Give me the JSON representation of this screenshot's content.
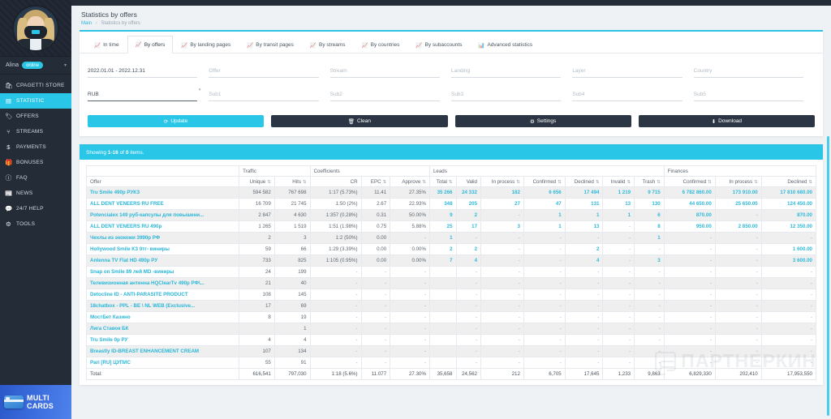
{
  "sidebar": {
    "user": {
      "name": "Alina",
      "status": "online",
      "caret": "chevron-down"
    },
    "items": [
      {
        "icon": "🛍",
        "label": "CPAGETTI STORE",
        "active": false
      },
      {
        "icon": "▤",
        "label": "STATISTIC",
        "active": true
      },
      {
        "icon": "🏷",
        "label": "OFFERS",
        "active": false
      },
      {
        "icon": "⑂",
        "label": "STREAMS",
        "active": false
      },
      {
        "icon": "$",
        "label": "PAYMENTS",
        "active": false
      },
      {
        "icon": "🎁",
        "label": "BONUSES",
        "active": false
      },
      {
        "icon": "ⓘ",
        "label": "FAQ",
        "active": false
      },
      {
        "icon": "📰",
        "label": "NEWS",
        "active": false
      },
      {
        "icon": "💬",
        "label": "24/7 HELP",
        "active": false
      },
      {
        "icon": "⚙",
        "label": "TOOLS",
        "active": false
      }
    ],
    "promo": {
      "line1": "MULTI",
      "line2": "CARDS"
    }
  },
  "header": {
    "title": "Statistics by offers",
    "breadcrumb_home": "Main",
    "breadcrumb_sep": "›",
    "breadcrumb_current": "Statistics by offers"
  },
  "tabs": [
    {
      "icon": "📈",
      "label": "In time",
      "active": false
    },
    {
      "icon": "📈",
      "label": "By offers",
      "active": true
    },
    {
      "icon": "📈",
      "label": "By landing pages",
      "active": false
    },
    {
      "icon": "📈",
      "label": "By transit pages",
      "active": false
    },
    {
      "icon": "📈",
      "label": "By streams",
      "active": false
    },
    {
      "icon": "📈",
      "label": "By countries",
      "active": false
    },
    {
      "icon": "📈",
      "label": "By subaccounts",
      "active": false
    },
    {
      "icon": "📊",
      "label": "Advanced statistics",
      "active": false
    }
  ],
  "filters": {
    "row1": [
      {
        "name": "date-range",
        "value": "2022.01.01 - 2022.12.31",
        "placeholder": ""
      },
      {
        "name": "offer",
        "value": "",
        "placeholder": "Offer"
      },
      {
        "name": "stream",
        "value": "",
        "placeholder": "Stream"
      },
      {
        "name": "landing",
        "value": "",
        "placeholder": "Landing"
      },
      {
        "name": "layer",
        "value": "",
        "placeholder": "Layer"
      },
      {
        "name": "country",
        "value": "",
        "placeholder": "Country"
      }
    ],
    "row2": [
      {
        "name": "currency",
        "value": "RUB",
        "placeholder": ""
      },
      {
        "name": "sub1",
        "value": "",
        "placeholder": "Sub1"
      },
      {
        "name": "sub2",
        "value": "",
        "placeholder": "Sub2"
      },
      {
        "name": "sub3",
        "value": "",
        "placeholder": "Sub3"
      },
      {
        "name": "sub4",
        "value": "",
        "placeholder": "Sub4"
      },
      {
        "name": "sub5",
        "value": "",
        "placeholder": "Sub5"
      }
    ]
  },
  "buttons": {
    "update": {
      "icon": "⟳",
      "label": "Update"
    },
    "clean": {
      "icon": "🗑",
      "label": "Clean"
    },
    "settings": {
      "icon": "⚙",
      "label": "Settings"
    },
    "download": {
      "icon": "⬇",
      "label": "Download"
    }
  },
  "showing": {
    "prefix": "Showing ",
    "range": "1-16",
    "mid": " of ",
    "count": "0",
    "suffix": " items."
  },
  "table": {
    "groups": [
      {
        "label": "",
        "span": 1
      },
      {
        "label": "Traffic",
        "span": 2
      },
      {
        "label": "Coefficients",
        "span": 3
      },
      {
        "label": "Leads",
        "span": 7
      },
      {
        "label": "Finances",
        "span": 3
      }
    ],
    "columns": [
      {
        "label": "Offer",
        "sortable": false,
        "align": "left"
      },
      {
        "label": "Unique",
        "sortable": true,
        "align": "right"
      },
      {
        "label": "Hits",
        "sortable": true,
        "align": "right"
      },
      {
        "label": "CR",
        "sortable": false,
        "align": "right"
      },
      {
        "label": "EPC",
        "sortable": true,
        "align": "right"
      },
      {
        "label": "Approve",
        "sortable": true,
        "align": "right"
      },
      {
        "label": "Total",
        "sortable": true,
        "align": "right"
      },
      {
        "label": "Valid",
        "sortable": false,
        "align": "right"
      },
      {
        "label": "In process",
        "sortable": true,
        "align": "right"
      },
      {
        "label": "Confirmed",
        "sortable": true,
        "align": "right"
      },
      {
        "label": "Declined",
        "sortable": true,
        "align": "right"
      },
      {
        "label": "Invalid",
        "sortable": true,
        "align": "right"
      },
      {
        "label": "Trash",
        "sortable": true,
        "align": "right"
      },
      {
        "label": "Confirmed",
        "sortable": true,
        "align": "right"
      },
      {
        "label": "In process",
        "sortable": true,
        "align": "right"
      },
      {
        "label": "Declined",
        "sortable": true,
        "align": "right"
      }
    ],
    "rows": [
      {
        "offer": "Tru Smile 490p РУКЗ",
        "cells": [
          "594 582",
          "767 698",
          "1:17 (5.73%)",
          "11.41",
          "27.35%",
          "35 266",
          "24 332",
          "182",
          "6 656",
          "17 494",
          "1 219",
          "9 715",
          "6 782 860.00",
          "173 910.00",
          "17 810 680.00"
        ]
      },
      {
        "offer": "ALL DENT VENEERS RU FREE",
        "cells": [
          "16 709",
          "21 745",
          "1:50 (2%)",
          "2.67",
          "22.93%",
          "348",
          "205",
          "27",
          "47",
          "131",
          "13",
          "130",
          "44 650.00",
          "25 650.00",
          "124 450.00"
        ]
      },
      {
        "offer": "Potencialex 149 руб-капсулы для повышени...",
        "cells": [
          "2 847",
          "4 630",
          "1:357 (0.28%)",
          "0.31",
          "50.00%",
          "9",
          "2",
          "-",
          "1",
          "1",
          "1",
          "6",
          "870.00",
          "-",
          "870.00"
        ]
      },
      {
        "offer": "ALL DENT VENEERS RU 490p",
        "cells": [
          "1 265",
          "1 519",
          "1:51 (1.98%)",
          "0.75",
          "5.88%",
          "25",
          "17",
          "3",
          "1",
          "13",
          "-",
          "8",
          "950.00",
          "2 850.00",
          "12 350.00"
        ]
      },
      {
        "offer": "Чехлы из экокожи 3990р РФ",
        "cells": [
          "2",
          "3",
          "1:2 (50%)",
          "0.00",
          "-",
          "1",
          "-",
          "-",
          "-",
          "-",
          "-",
          "1",
          "-",
          "-",
          "-"
        ]
      },
      {
        "offer": "Hollywood Smile КЗ 0тг- виниры",
        "cells": [
          "59",
          "66",
          "1:29 (3.39%)",
          "0.00",
          "0.00%",
          "2",
          "2",
          "-",
          "-",
          "2",
          "-",
          "-",
          "-",
          "-",
          "1 600.00"
        ]
      },
      {
        "offer": "Antenna TV Flat HD 490p РУ",
        "cells": [
          "733",
          "825",
          "1:105 (0.95%)",
          "0.00",
          "0.00%",
          "7",
          "4",
          "-",
          "-",
          "4",
          "-",
          "3",
          "-",
          "-",
          "3 600.00"
        ]
      },
      {
        "offer": "Snap on Smile 89 лей MD -виниры",
        "cells": [
          "24",
          "199",
          "-",
          "-",
          "-",
          "",
          "-",
          "-",
          "-",
          "-",
          "-",
          "-",
          "-",
          "-",
          "-"
        ]
      },
      {
        "offer": "Телевизионная антенна HQClearTv 490p РФ\\...",
        "cells": [
          "21",
          "40",
          "-",
          "-",
          "-",
          "",
          "-",
          "-",
          "-",
          "-",
          "-",
          "-",
          "-",
          "-",
          "-"
        ]
      },
      {
        "offer": "Detocline ID - ANTI-PARASITE PRODUCT",
        "cells": [
          "108",
          "145",
          "-",
          "-",
          "-",
          "",
          "-",
          "-",
          "-",
          "-",
          "-",
          "-",
          "-",
          "-",
          "-"
        ]
      },
      {
        "offer": "18chatbox - PPL - BE \\ NL WEB (Exclusive...",
        "cells": [
          "17",
          "69",
          "-",
          "-",
          "-",
          "",
          "-",
          "-",
          "-",
          "-",
          "-",
          "-",
          "-",
          "-",
          "-"
        ]
      },
      {
        "offer": "МостБет Казино",
        "cells": [
          "8",
          "19",
          "-",
          "-",
          "-",
          "",
          "-",
          "-",
          "-",
          "-",
          "-",
          "-",
          "-",
          "-",
          "-"
        ]
      },
      {
        "offer": "Лига Ставок БК",
        "cells": [
          "",
          "1",
          "-",
          "-",
          "-",
          "",
          "-",
          "-",
          "-",
          "-",
          "-",
          "-",
          "-",
          "-",
          "-"
        ]
      },
      {
        "offer": "Tru Smile 0p РУ",
        "cells": [
          "4",
          "4",
          "-",
          "-",
          "-",
          "",
          "-",
          "-",
          "-",
          "-",
          "-",
          "-",
          "-",
          "-",
          "-"
        ]
      },
      {
        "offer": "Breastly ID-BREAST ENHANCEMENT CREAM",
        "cells": [
          "107",
          "134",
          "-",
          "-",
          "-",
          "",
          "-",
          "-",
          "-",
          "-",
          "-",
          "-",
          "-",
          "-",
          "-"
        ]
      },
      {
        "offer": "Pari [RU] ЦУПИС",
        "cells": [
          "55",
          "91",
          "-",
          "-",
          "-",
          "",
          "-",
          "-",
          "-",
          "-",
          "-",
          "-",
          "-",
          "-",
          "-"
        ]
      }
    ],
    "total": {
      "label": "Total:",
      "cells": [
        "616,541",
        "797,030",
        "1:18 (5.6%)",
        "11.077",
        "27.30%",
        "35,658",
        "24,562",
        "212",
        "6,705",
        "17,645",
        "1,233",
        "9,863",
        "6,829,330",
        "202,410",
        "17,953,550"
      ]
    }
  },
  "watermark": {
    "text": "ПАРТНЕРКИН"
  },
  "colors": {
    "accent": "#29c6e8",
    "dark": "#242c38",
    "link": "#29b6d8"
  }
}
